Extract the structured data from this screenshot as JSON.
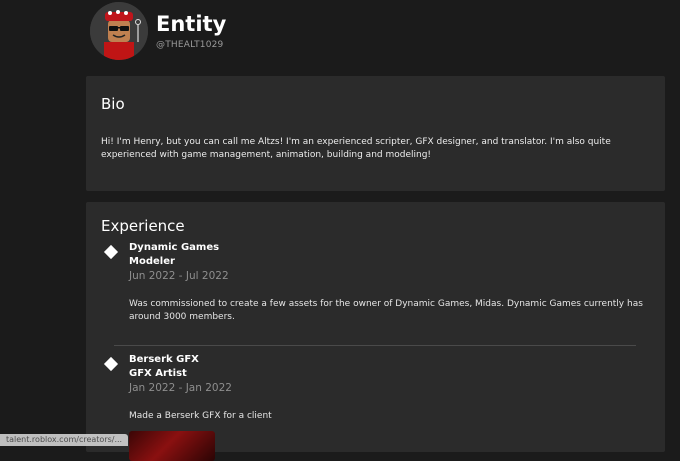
{
  "profile": {
    "display_name": "Entity",
    "username": "@THEALT1029"
  },
  "bio": {
    "title": "Bio",
    "text": "Hi! I'm Henry, but you can call me Altzs! I'm an experienced scripter, GFX designer, and translator. I'm also quite experienced with game management, animation, building and modeling!"
  },
  "experience": {
    "title": "Experience",
    "items": [
      {
        "company": "Dynamic Games",
        "role": "Modeler",
        "dates": "Jun 2022 - Jul 2022",
        "description": "Was commissioned to create a few assets for the owner of Dynamic Games, Midas. Dynamic Games currently has around 3000 members."
      },
      {
        "company": "Berserk GFX",
        "role": "GFX Artist",
        "dates": "Jan 2022 - Jan 2022",
        "description": "Made a Berserk GFX for a client"
      }
    ]
  },
  "status_bar": {
    "url": "talent.roblox.com/creators/..."
  },
  "colors": {
    "background": "#1b1b1b",
    "card": "#2b2b2b",
    "muted_text": "#8e8e8e"
  }
}
